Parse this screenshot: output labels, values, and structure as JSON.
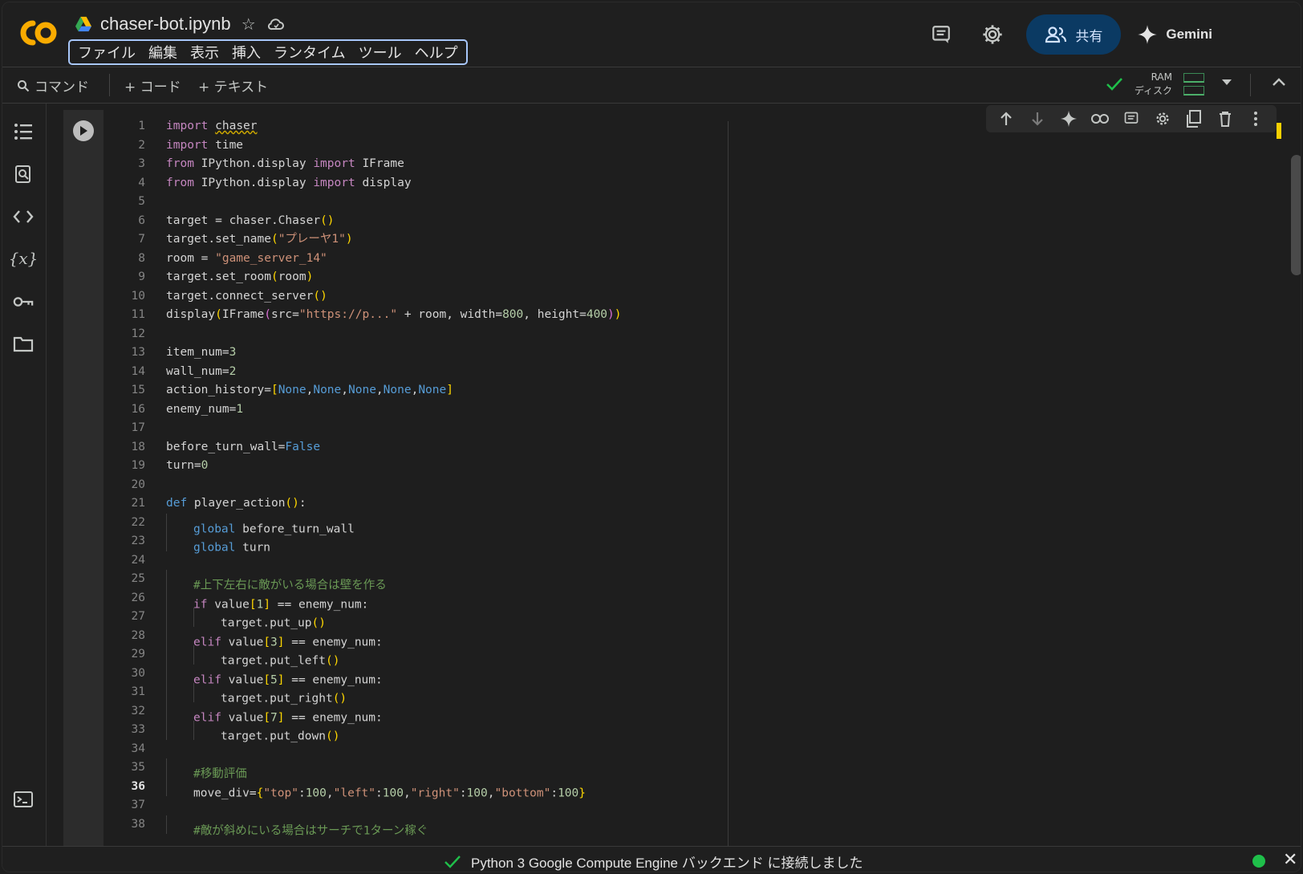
{
  "header": {
    "logo_text": "CO",
    "doc_title": "chaser-bot.ipynb",
    "menu": [
      "ファイル",
      "編集",
      "表示",
      "挿入",
      "ランタイム",
      "ツール",
      "ヘルプ"
    ],
    "share_label": "共有",
    "gemini_label": "Gemini"
  },
  "toolbar": {
    "command_label": "コマンド",
    "add_code_label": "+ コード",
    "add_text_label": "+ テキスト",
    "ram_label": "RAM",
    "disk_label": "ディスク"
  },
  "colors": {
    "accent": "#a8c7fa",
    "share_bg": "#0b3a63",
    "logo_orange": "#f9ab00",
    "status_green": "#1fbf4a"
  },
  "code_lines": [
    {
      "n": "1",
      "t": "import chaser"
    },
    {
      "n": "2",
      "t": "import time"
    },
    {
      "n": "3",
      "t": "from IPython.display import IFrame"
    },
    {
      "n": "4",
      "t": "from IPython.display import display"
    },
    {
      "n": "5",
      "t": ""
    },
    {
      "n": "6",
      "t": "target = chaser.Chaser()"
    },
    {
      "n": "7",
      "t": "target.set_name(\"プレーヤ1\")"
    },
    {
      "n": "8",
      "t": "room = \"game_server_14\""
    },
    {
      "n": "9",
      "t": "target.set_room(room)"
    },
    {
      "n": "10",
      "t": "target.connect_server()"
    },
    {
      "n": "11",
      "t": "display(IFrame(src=\"https://p...\" + room, width=800, height=400))"
    },
    {
      "n": "12",
      "t": ""
    },
    {
      "n": "13",
      "t": "item_num=3"
    },
    {
      "n": "14",
      "t": "wall_num=2"
    },
    {
      "n": "15",
      "t": "action_history=[None,None,None,None,None]"
    },
    {
      "n": "16",
      "t": "enemy_num=1"
    },
    {
      "n": "17",
      "t": ""
    },
    {
      "n": "18",
      "t": "before_turn_wall=False"
    },
    {
      "n": "19",
      "t": "turn=0"
    },
    {
      "n": "20",
      "t": ""
    },
    {
      "n": "21",
      "t": "def player_action():"
    },
    {
      "n": "22",
      "t": "    global before_turn_wall"
    },
    {
      "n": "23",
      "t": "    global turn"
    },
    {
      "n": "24",
      "t": ""
    },
    {
      "n": "25",
      "t": "    #上下左右に敵がいる場合は壁を作る"
    },
    {
      "n": "26",
      "t": "    if value[1] == enemy_num:"
    },
    {
      "n": "27",
      "t": "        target.put_up()"
    },
    {
      "n": "28",
      "t": "    elif value[3] == enemy_num:"
    },
    {
      "n": "29",
      "t": "        target.put_left()"
    },
    {
      "n": "30",
      "t": "    elif value[5] == enemy_num:"
    },
    {
      "n": "31",
      "t": "        target.put_right()"
    },
    {
      "n": "32",
      "t": "    elif value[7] == enemy_num:"
    },
    {
      "n": "33",
      "t": "        target.put_down()"
    },
    {
      "n": "34",
      "t": ""
    },
    {
      "n": "35",
      "t": "    #移動評価"
    },
    {
      "n": "36",
      "t": "    move_div={\"top\":100,\"left\":100,\"right\":100,\"bottom\":100}"
    },
    {
      "n": "37",
      "t": ""
    },
    {
      "n": "38",
      "t": "    #敵が斜めにいる場合はサーチで1ターン稼ぐ"
    }
  ],
  "status": {
    "message": "Python 3 Google Compute Engine バックエンド に接続しました"
  }
}
